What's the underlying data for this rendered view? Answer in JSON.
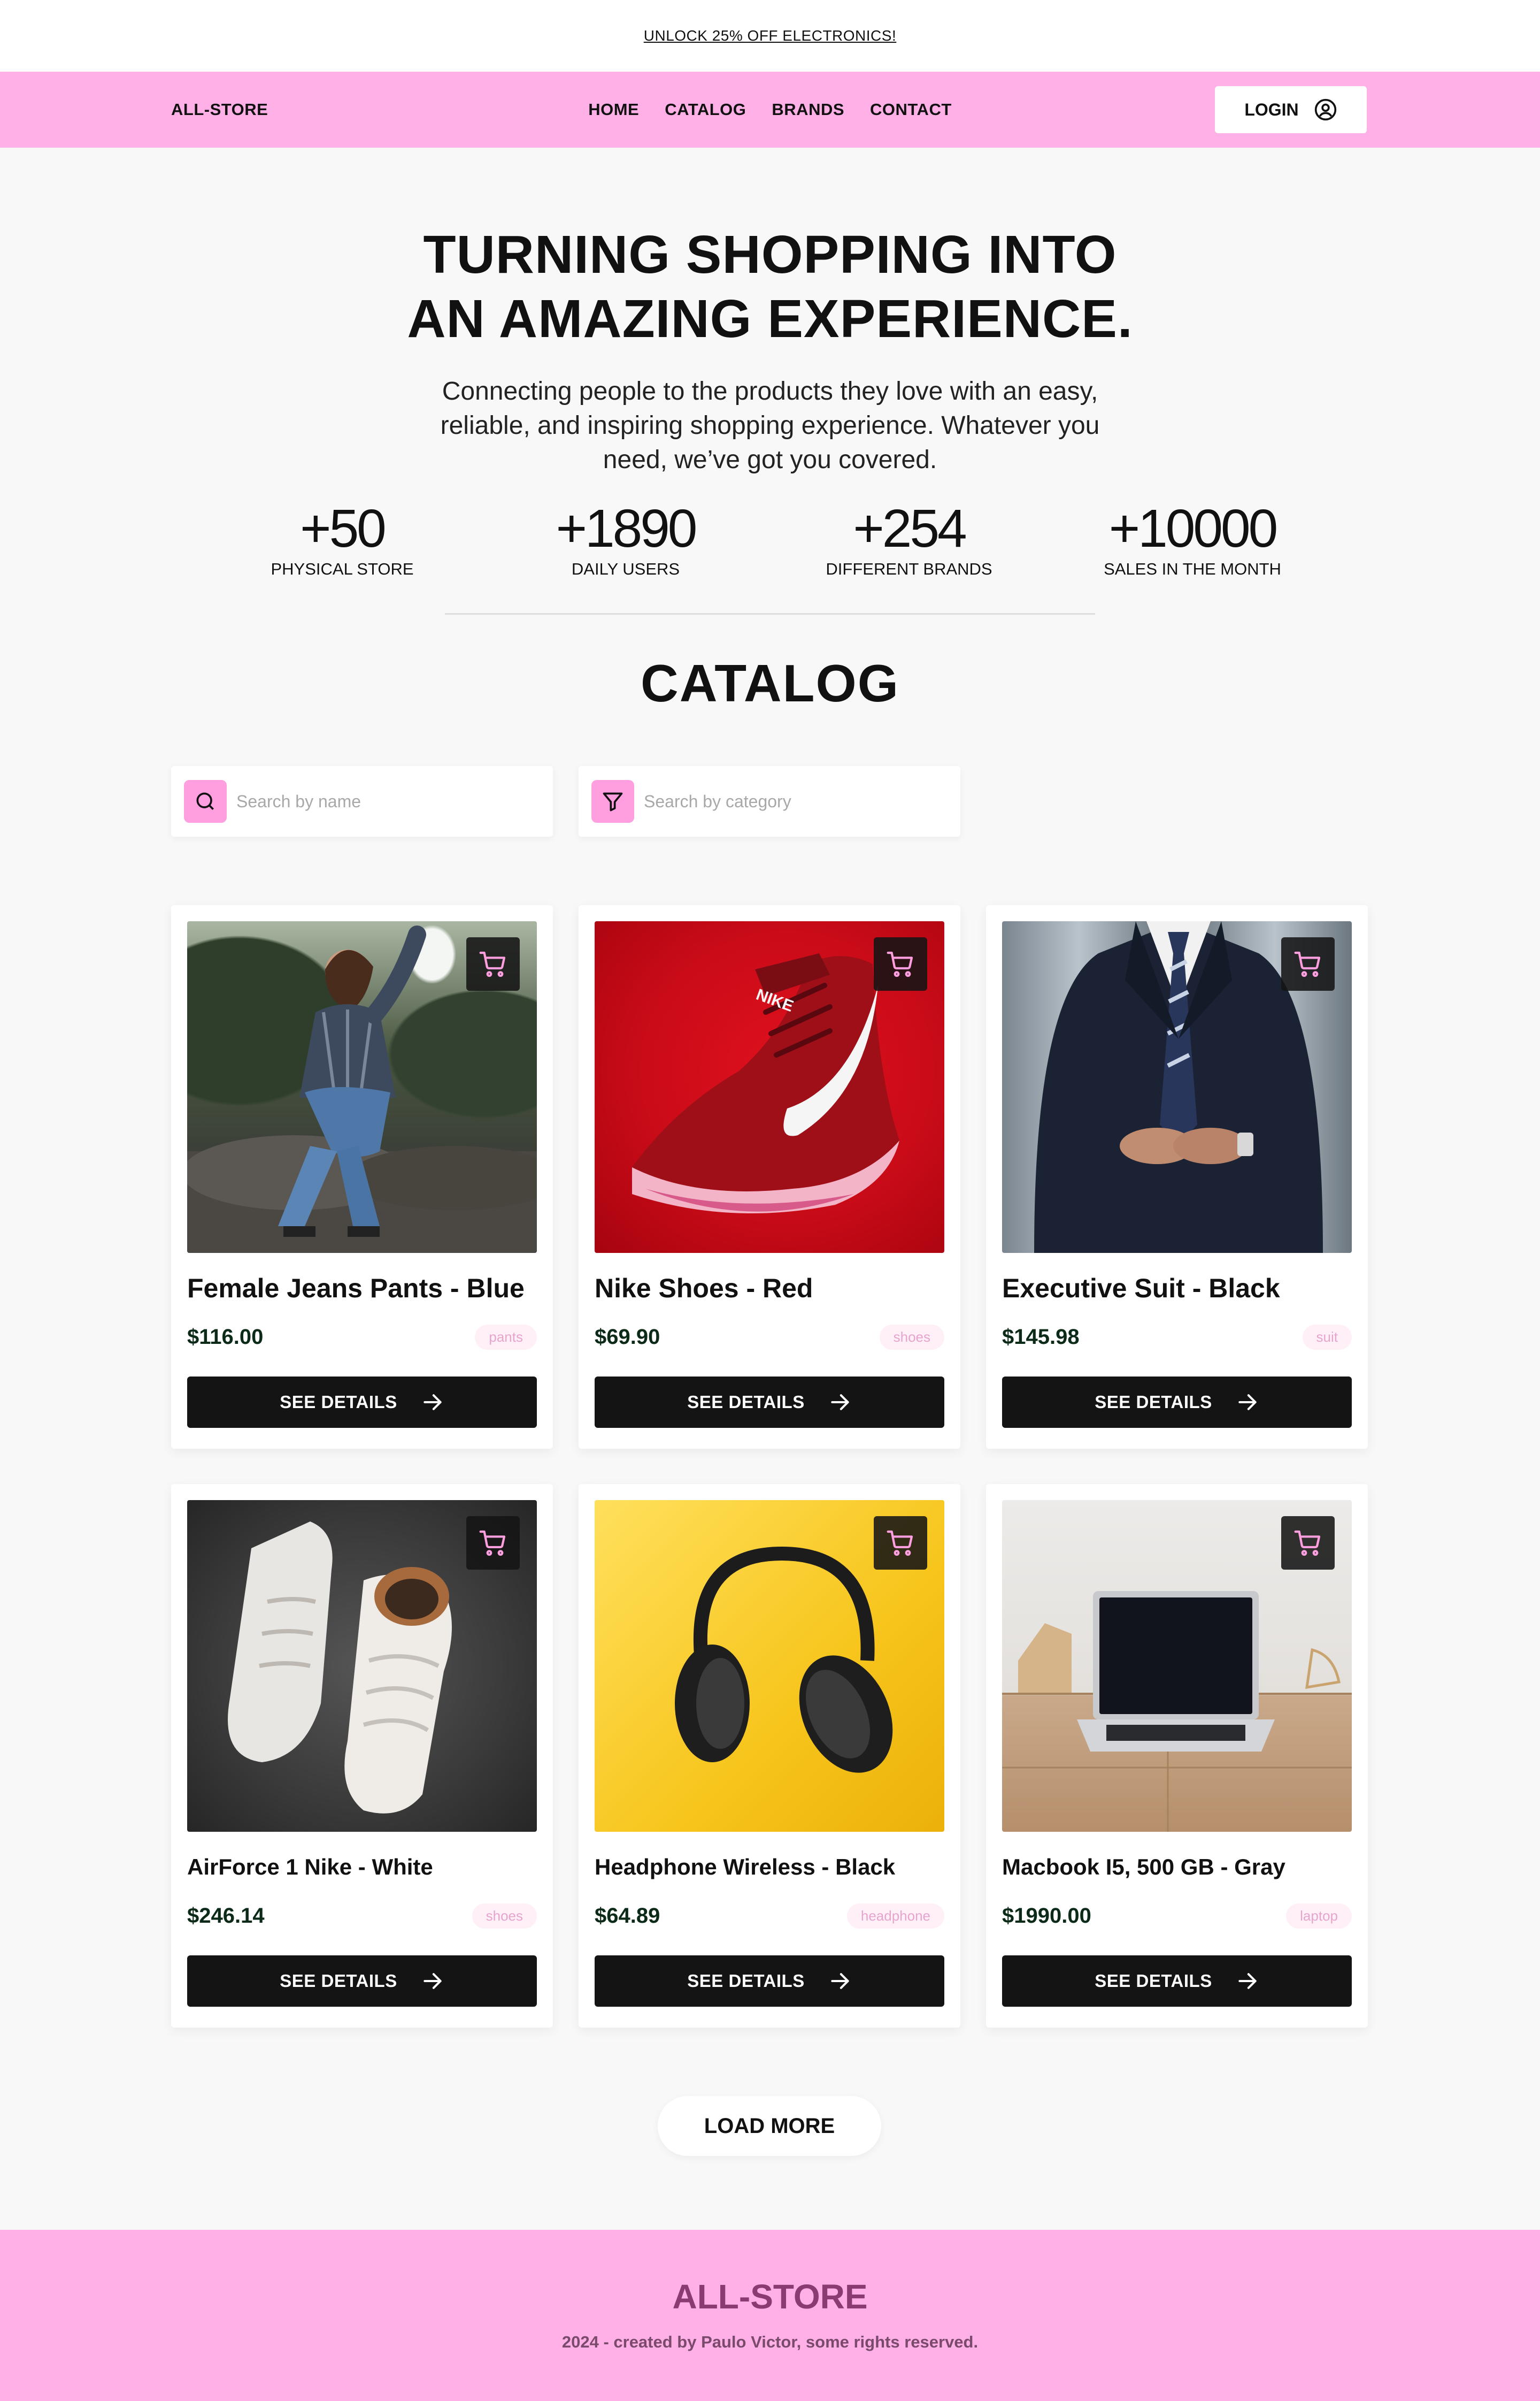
{
  "promo": {
    "text": "UNLOCK 25% OFF ELECTRONICS!"
  },
  "header": {
    "brand": "ALL-STORE",
    "nav": [
      "HOME",
      "CATALOG",
      "BRANDS",
      "CONTACT"
    ],
    "login_label": "LOGIN"
  },
  "hero": {
    "title_line1": "TURNING SHOPPING INTO",
    "title_line2": "AN AMAZING EXPERIENCE.",
    "subtitle": "Connecting people to the products they love with an easy, reliable, and inspiring shopping experience. Whatever you need, we’ve got you covered."
  },
  "stats": [
    {
      "value": "+50",
      "label": "PHYSICAL STORE"
    },
    {
      "value": "+1890",
      "label": "DAILY USERS"
    },
    {
      "value": "+254",
      "label": "DIFFERENT BRANDS"
    },
    {
      "value": "+10000",
      "label": "SALES IN THE MONTH"
    }
  ],
  "catalog": {
    "title": "CATALOG",
    "search_name_placeholder": "Search by name",
    "search_category_placeholder": "Search by category",
    "details_label": "SEE DETAILS",
    "load_more_label": "LOAD MORE"
  },
  "products": [
    {
      "name": "Female Jeans Pants - Blue",
      "price": "$116.00",
      "category": "pants",
      "image": "jeans-model-photo"
    },
    {
      "name": "Nike Shoes - Red",
      "price": "$69.90",
      "category": "shoes",
      "image": "red-nike-shoe-photo"
    },
    {
      "name": "Executive Suit - Black",
      "price": "$145.98",
      "category": "suit",
      "image": "suit-photo"
    },
    {
      "name": "AirForce 1 Nike - White",
      "price": "$246.14",
      "category": "shoes",
      "image": "white-sneakers-photo"
    },
    {
      "name": "Headphone Wireless - Black",
      "price": "$64.89",
      "category": "headphone",
      "image": "black-headphones-photo"
    },
    {
      "name": "Macbook I5, 500 GB - Gray",
      "price": "$1990.00",
      "category": "laptop",
      "image": "laptop-photo"
    }
  ],
  "footer": {
    "brand": "ALL-STORE",
    "copyright": "2024 - created by Paulo Victor, some rights reserved."
  },
  "colors": {
    "accent_pink": "#ffb0e6",
    "icon_pink": "#ff9fdf",
    "dark_button": "#141414",
    "price_green": "#0c2a18"
  }
}
